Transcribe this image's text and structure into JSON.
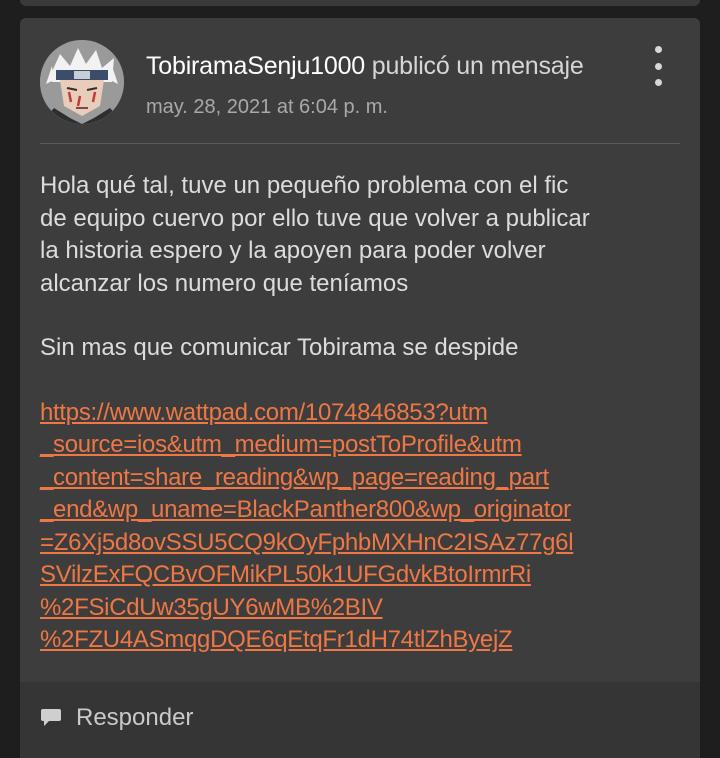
{
  "post": {
    "author": "TobiramaSenju1000",
    "action": "publicó un mensaje",
    "date": "may. 28, 2021 at 6:04 p. m.",
    "body_lines": [
      "Hola qué tal, tuve un pequeño problema con el fic",
      "de equipo cuervo por ello tuve que volver a publicar",
      "la historia espero y la apoyen para poder volver",
      "alcanzar los numero que teníamos"
    ],
    "closing": "Sin mas que comunicar Tobirama se despide",
    "link_lines": [
      "https://www.wattpad.com/1074846853?utm",
      "_source=ios&utm_medium=postToProfile&utm",
      "_content=share_reading&wp_page=reading_part",
      "_end&wp_uname=BlackPanther800&wp_originator",
      "=Z6Xj5d8ovSSU5CQ9kOyFphbMXHnC2ISAz77g6l",
      "SVilzExFQCBvOFMikPL50k1UFGdvkBtoIrmrRi",
      "%2FSiCdUw35gUY6wMB%2BIV",
      "%2FZU4ASmqgDQE6qEtqFr1dH74tlZhByejZ"
    ]
  },
  "footer": {
    "reply_label": "Responder",
    "reply_icon": "speech-bubble-icon"
  },
  "icons": {
    "menu": "vertical-dots-icon"
  },
  "colors": {
    "card_bg": "#3d3d3d",
    "link": "#ee7744",
    "text": "#dcdcdc"
  }
}
